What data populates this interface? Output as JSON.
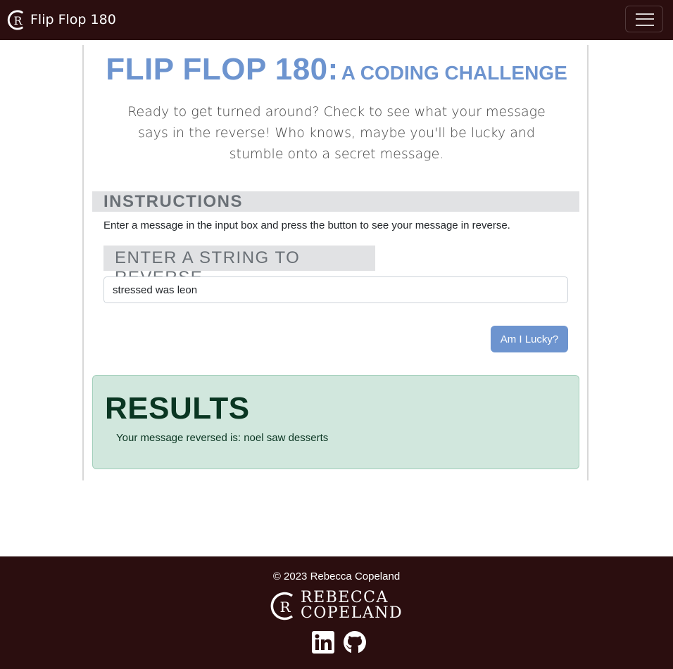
{
  "navbar": {
    "brand_text": "Flip Flop 180",
    "logo_icon": "rc-monogram-icon",
    "menu_icon": "hamburger-menu-icon"
  },
  "hero": {
    "title_main": "FLIP FLOP 180:",
    "title_sub": "A CODING CHALLENGE",
    "lead": "Ready to get turned around? Check to see what your message says in the reverse! Who knows, maybe you'll be lucky and stumble onto a secret message."
  },
  "instructions": {
    "heading": "INSTRUCTIONS",
    "text": "Enter a message in the input box and press the button to see your message in reverse."
  },
  "form": {
    "input_label": "ENTER A STRING TO REVERSE",
    "input_value": "stressed was leon",
    "button_label": "Am I Lucky?"
  },
  "results": {
    "heading": "RESULTS",
    "text": "Your message reversed is: noel saw desserts"
  },
  "footer": {
    "copyright": "© 2023 Rebecca Copeland",
    "logo_line1": "REBECCA",
    "logo_line2": "COPELAND",
    "social_icons": [
      "linkedin-icon",
      "github-icon"
    ]
  },
  "colors": {
    "navbar_bg": "#2b0e0f",
    "accent": "#6d94cf",
    "results_bg": "#d1e7dd",
    "results_text": "#0a3622",
    "label_bg": "#e1e2e4"
  }
}
